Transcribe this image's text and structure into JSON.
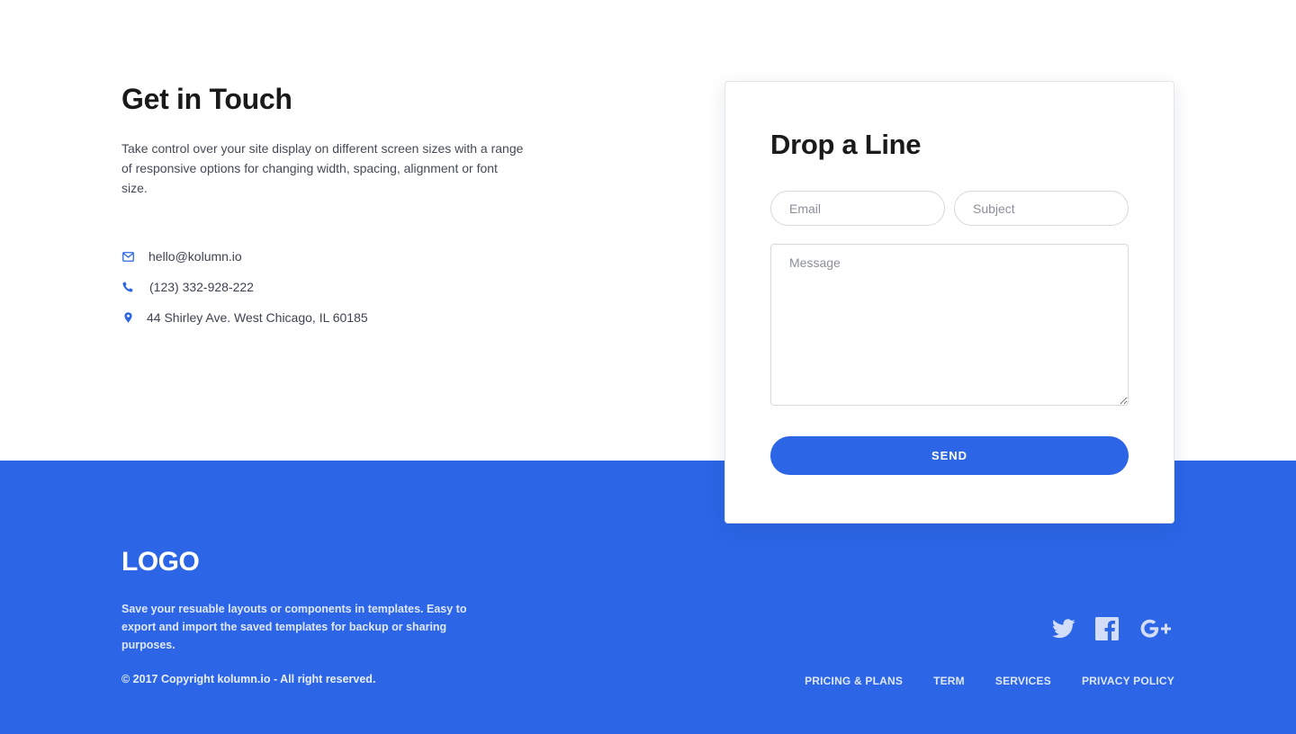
{
  "contact": {
    "title": "Get in Touch",
    "description": "Take control over your site display on different screen sizes with a range of responsive options for changing width, spacing, alignment or font size.",
    "items": [
      {
        "icon": "envelope-icon",
        "text": "hello@kolumn.io"
      },
      {
        "icon": "phone-icon",
        "text": "(123) 332-928-222"
      },
      {
        "icon": "map-pin-icon",
        "text": "44 Shirley Ave. West Chicago, IL 60185"
      }
    ]
  },
  "form": {
    "title": "Drop a Line",
    "email_placeholder": "Email",
    "subject_placeholder": "Subject",
    "message_placeholder": "Message",
    "send_label": "SEND"
  },
  "footer": {
    "logo": "LOGO",
    "description": "Save your resuable layouts or components in templates. Easy to export and import the saved templates for backup or sharing purposes.",
    "copyright": "© 2017 Copyright kolumn.io - All right reserved.",
    "socials": [
      "twitter-icon",
      "facebook-icon",
      "google-plus-icon"
    ],
    "nav": [
      "PRICING & PLANS",
      "TERM",
      "SERVICES",
      "PRIVACY POLICY"
    ]
  },
  "colors": {
    "accent": "#2c66e6",
    "heading": "#1a1a1a",
    "body_text": "#444a55"
  }
}
